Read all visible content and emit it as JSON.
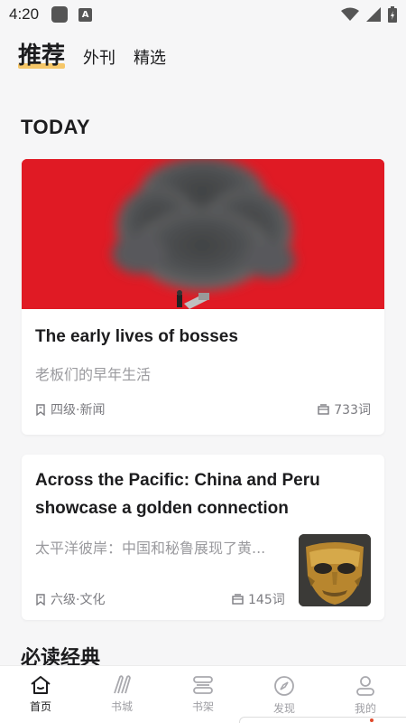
{
  "status_bar": {
    "time": "4:20",
    "icons": [
      "notification-square-icon",
      "a-badge-icon",
      "wifi-icon",
      "signal-icon",
      "battery-charging-icon"
    ]
  },
  "top_tabs": [
    {
      "label": "推荐",
      "active": true
    },
    {
      "label": "外刊",
      "active": false
    },
    {
      "label": "精选",
      "active": false
    }
  ],
  "section_today": "TODAY",
  "cards": [
    {
      "title": "The early lives of bosses",
      "subtitle": "老板们的早年生活",
      "level": "四级·新闻",
      "word_count": "733词",
      "has_hero_image": true,
      "hero_color": "#e01a24"
    },
    {
      "title_line1": "Across the Pacific: China and Peru",
      "title_line2": "showcase a golden connection",
      "subtitle": "太平洋彼岸：中国和秘鲁展现了黄...",
      "level": "六级·文化",
      "word_count": "145词",
      "has_thumbnail": true
    }
  ],
  "section_classics": "必读经典",
  "bottom_nav": [
    {
      "label": "首页",
      "icon": "home-icon",
      "active": true
    },
    {
      "label": "书城",
      "icon": "bookstore-icon",
      "active": false
    },
    {
      "label": "书架",
      "icon": "bookshelf-icon",
      "active": false
    },
    {
      "label": "发现",
      "icon": "compass-icon",
      "active": false
    },
    {
      "label": "我的",
      "icon": "profile-icon",
      "active": false
    }
  ],
  "colors": {
    "accent_underline": "#f5b73a",
    "background": "#f6f6f7",
    "text_primary": "#1c1c1e",
    "text_secondary": "#9a9a9e"
  }
}
